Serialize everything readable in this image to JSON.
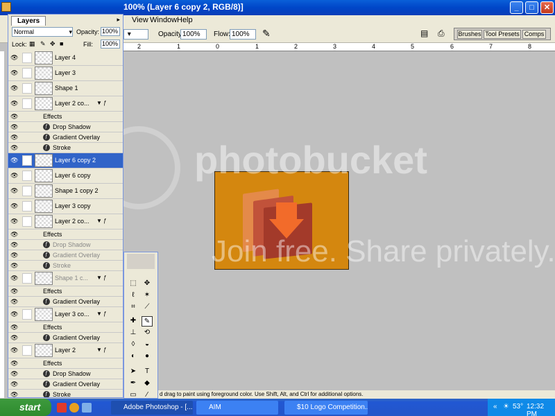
{
  "window": {
    "title": "100% (Layer 6 copy 2, RGB/8)]",
    "minimize_label": "_",
    "maximize_label": "□",
    "close_label": "✕"
  },
  "menu": [
    "View",
    "Window",
    "Help"
  ],
  "options_bar": {
    "opacity_label": "Opacity:",
    "opacity_value": "100%",
    "flow_label": "Flow:",
    "flow_value": "100%",
    "wells_tabs": [
      "Brushes",
      "Tool Presets",
      "Comps"
    ]
  },
  "ruler": {
    "marks": [
      "2",
      "1",
      "0",
      "1",
      "2",
      "3",
      "4",
      "5",
      "6",
      "7",
      "8"
    ]
  },
  "layers_panel": {
    "tab_label": "Layers",
    "blend_mode": "Normal",
    "opacity_label": "Opacity:",
    "opacity_value": "100%",
    "lock_label": "Lock:",
    "fill_label": "Fill:",
    "fill_value": "100%",
    "rows": [
      {
        "kind": "layer",
        "name": "Layer 4"
      },
      {
        "kind": "layer",
        "name": "Layer 3"
      },
      {
        "kind": "layer",
        "name": "Shape 1"
      },
      {
        "kind": "layer",
        "name": "Layer 2 co...",
        "fx": true
      },
      {
        "kind": "fx",
        "name": "Effects"
      },
      {
        "kind": "fx",
        "name": "Drop Shadow"
      },
      {
        "kind": "fx",
        "name": "Gradient Overlay"
      },
      {
        "kind": "fx",
        "name": "Stroke"
      },
      {
        "kind": "layer",
        "name": "Layer 6 copy 2",
        "selected": true
      },
      {
        "kind": "layer",
        "name": "Layer 6 copy"
      },
      {
        "kind": "layer",
        "name": "Shape 1 copy 2"
      },
      {
        "kind": "layer",
        "name": "Layer 3 copy"
      },
      {
        "kind": "layer",
        "name": "Layer 2 co...",
        "fx": true
      },
      {
        "kind": "fx",
        "name": "Effects"
      },
      {
        "kind": "fx",
        "name": "Drop Shadow",
        "dim": true
      },
      {
        "kind": "fx",
        "name": "Gradient Overlay",
        "dim": true
      },
      {
        "kind": "fx",
        "name": "Stroke",
        "dim": true
      },
      {
        "kind": "layer",
        "name": "Shape 1 c...",
        "fx": true,
        "dim": true
      },
      {
        "kind": "fx",
        "name": "Effects"
      },
      {
        "kind": "fx",
        "name": "Gradient Overlay"
      },
      {
        "kind": "layer",
        "name": "Layer 3 co...",
        "fx": true
      },
      {
        "kind": "fx",
        "name": "Effects"
      },
      {
        "kind": "fx",
        "name": "Gradient Overlay"
      },
      {
        "kind": "layer",
        "name": "Layer 2",
        "fx": true
      },
      {
        "kind": "fx",
        "name": "Effects"
      },
      {
        "kind": "fx",
        "name": "Drop Shadow"
      },
      {
        "kind": "fx",
        "name": "Gradient Overlay"
      },
      {
        "kind": "fx",
        "name": "Stroke"
      }
    ]
  },
  "canvas": {
    "watermark_top": "photobucket",
    "watermark_bottom": "Join free. Share privately."
  },
  "status_text": "d drag to paint using foreground color.  Use Shift, Alt, and Ctrl for additional options.",
  "taskbar": {
    "start_label": "start",
    "buttons": [
      "Adobe Photoshop - [...",
      "AIM",
      "$10 Logo Competition..."
    ],
    "temperature": "53°",
    "clock": "12:32 PM"
  },
  "colors": {
    "canvas_orange": "#d4870f",
    "selection_blue": "#3164c8",
    "xp_title_blue": "#0046c8"
  }
}
